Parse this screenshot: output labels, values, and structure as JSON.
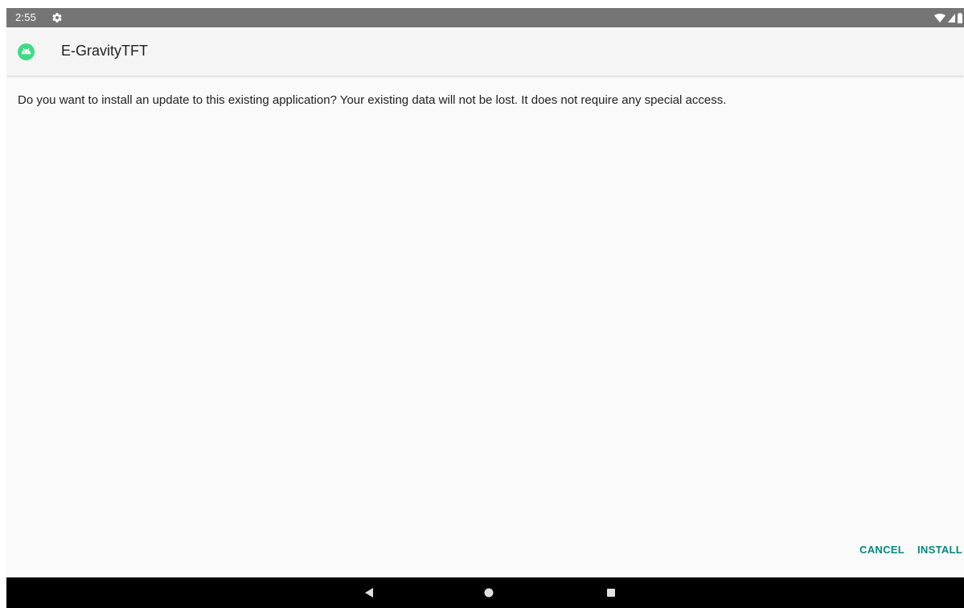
{
  "status_bar": {
    "time": "2:55",
    "icons": [
      "settings-icon",
      "wifi-icon",
      "signal-icon",
      "battery-icon"
    ]
  },
  "app_bar": {
    "app_icon": "android-app-icon",
    "title": "E-GravityTFT"
  },
  "dialog": {
    "message": "Do you want to install an update to this existing application? Your existing data will not be lost. It does not require any special access."
  },
  "actions": {
    "cancel_label": "CANCEL",
    "install_label": "INSTALL"
  },
  "nav_bar": {
    "icons": [
      "back-icon",
      "home-icon",
      "recents-icon"
    ]
  },
  "colors": {
    "status_bar": "#757575",
    "app_bar": "#f5f5f5",
    "background": "#fafafa",
    "accent": "#00897b",
    "app_icon_green": "#3ddc84",
    "nav_bar": "#000000"
  }
}
